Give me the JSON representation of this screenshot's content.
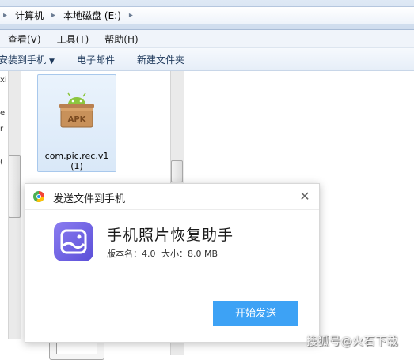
{
  "address_bar": {
    "crumbs": [
      "计算机",
      "本地磁盘 (E:)"
    ]
  },
  "menu_bar": {
    "items": [
      "查看(V)",
      "工具(T)",
      "帮助(H)"
    ]
  },
  "command_bar": {
    "items": [
      "安装到手机",
      "电子邮件",
      "新建文件夹"
    ]
  },
  "nav_pane": {
    "fragments": [
      "xi",
      "e",
      "r",
      "("
    ]
  },
  "files": [
    {
      "name": "com.pic.rec.v1\n(1)",
      "icon": "apk-icon",
      "icon_label": "APK"
    }
  ],
  "dialog": {
    "title": "发送文件到手机",
    "app_name": "手机照片恢复助手",
    "version_text": "版本名：4.0",
    "size_text": "大小：8.0 MB",
    "send_button": "开始发送",
    "close_glyph": "✕"
  },
  "watermark": "搜狐号@火石下载",
  "colors": {
    "accent_button": "#3da2f5",
    "app_icon": "#6b5ee6",
    "apk_green": "#8cc63e"
  }
}
